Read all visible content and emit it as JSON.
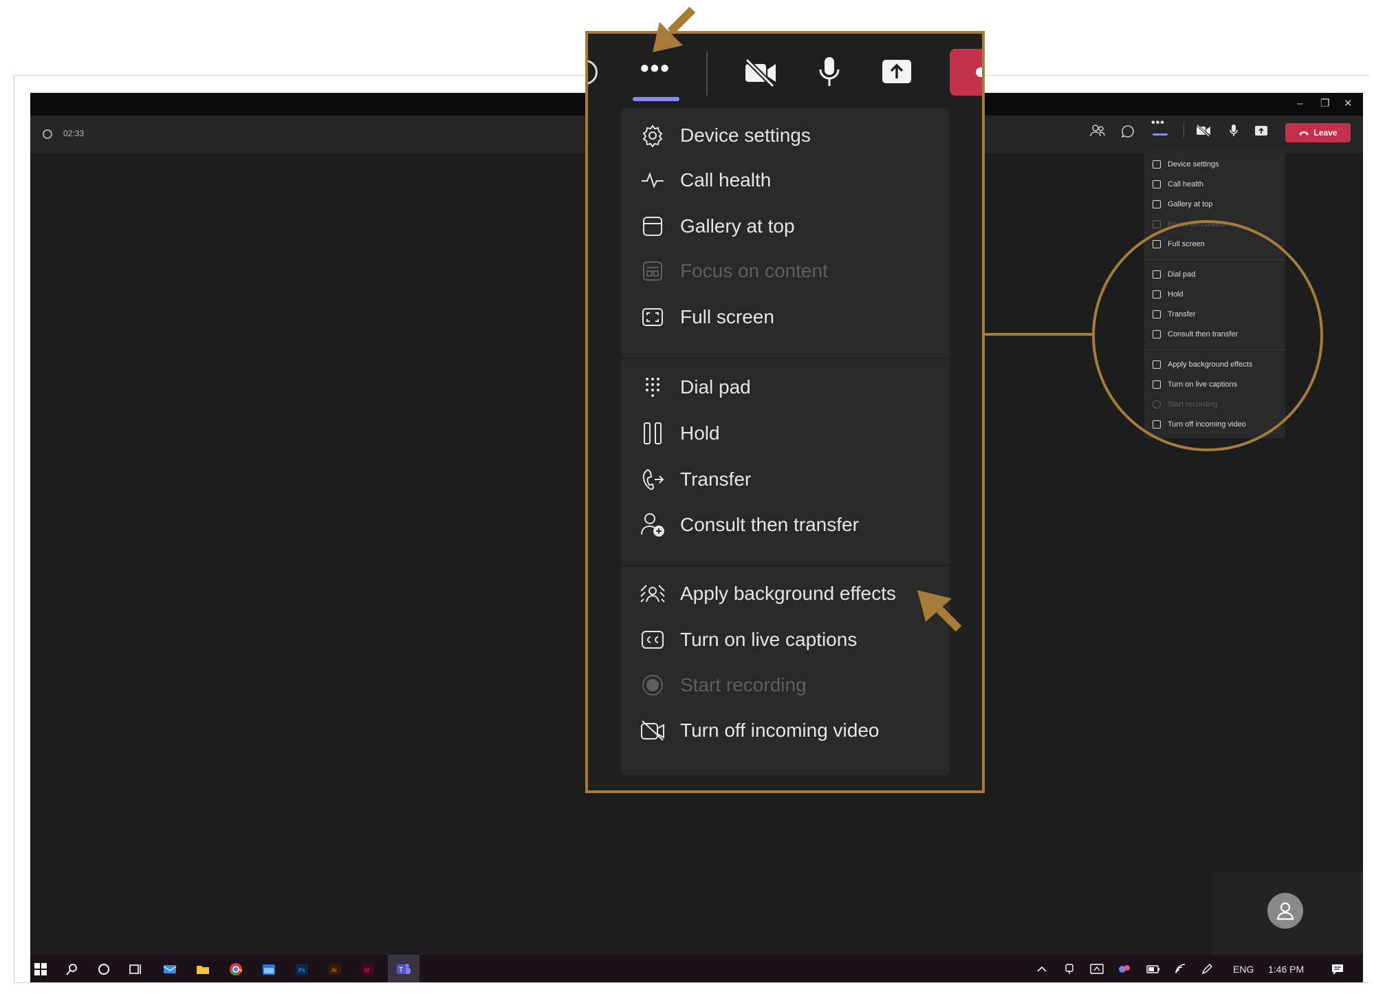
{
  "window": {
    "call_timer": "02:33",
    "controls": [
      "–",
      "❐",
      "✕"
    ]
  },
  "call_toolbar": {
    "leave_label": "Leave"
  },
  "menu": {
    "groups": [
      [
        {
          "label": "Device settings",
          "icon": "gear-icon",
          "enabled": true
        },
        {
          "label": "Call health",
          "icon": "pulse-icon",
          "enabled": true
        },
        {
          "label": "Gallery at top",
          "icon": "gallery-top-icon",
          "enabled": true
        },
        {
          "label": "Focus on content",
          "icon": "focus-content-icon",
          "enabled": false
        },
        {
          "label": "Full screen",
          "icon": "fullscreen-icon",
          "enabled": true
        }
      ],
      [
        {
          "label": "Dial pad",
          "icon": "dialpad-icon",
          "enabled": true
        },
        {
          "label": "Hold",
          "icon": "pause-icon",
          "enabled": true
        },
        {
          "label": "Transfer",
          "icon": "transfer-icon",
          "enabled": true
        },
        {
          "label": "Consult then transfer",
          "icon": "consult-transfer-icon",
          "enabled": true
        }
      ],
      [
        {
          "label": "Apply background effects",
          "icon": "background-effects-icon",
          "enabled": true
        },
        {
          "label": "Turn on live captions",
          "icon": "captions-icon",
          "enabled": true
        },
        {
          "label": "Start recording",
          "icon": "record-icon",
          "enabled": false
        },
        {
          "label": "Turn off incoming video",
          "icon": "video-off-icon",
          "enabled": true
        }
      ]
    ]
  },
  "taskbar": {
    "language": "ENG",
    "time": "1:46 PM"
  },
  "colors": {
    "callout": "#a77c3a",
    "leave": "#c4314b",
    "accent": "#8b8cf7"
  }
}
